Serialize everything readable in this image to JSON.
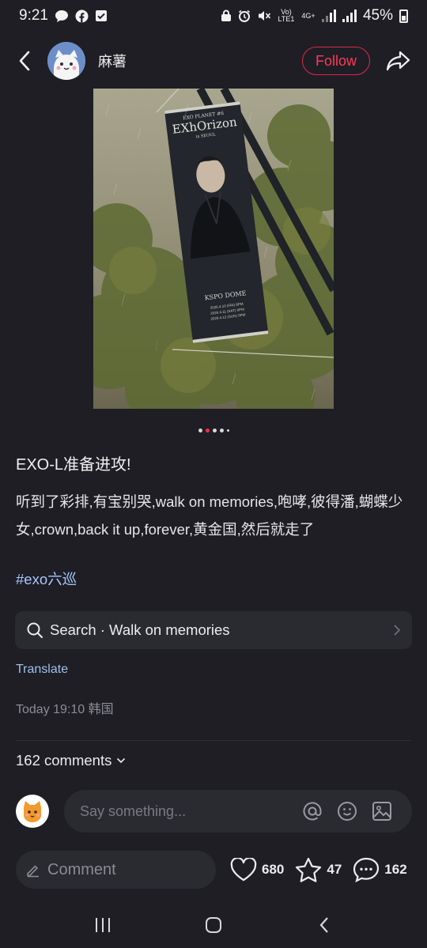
{
  "status_bar": {
    "time": "9:21",
    "network_volte": "Vo) LTE1",
    "network_type": "4G+",
    "battery": "45%",
    "left_icons": [
      "chat-bubble-icon",
      "facebook-icon",
      "check-square-icon"
    ],
    "right_icons": [
      "lock-icon",
      "alarm-icon",
      "mute-icon",
      "signal-icon",
      "signal-icon",
      "battery-icon"
    ]
  },
  "header": {
    "username": "麻薯",
    "follow_label": "Follow"
  },
  "post": {
    "carousel": {
      "count": 5,
      "active_index": 1
    },
    "title": "EXO-L准备进攻!",
    "body": "听到了彩排,有宝别哭,walk on memories,咆哮,彼得潘,蝴蝶少女,crown,back it up,forever,黄金国,然后就走了",
    "hashtag": "#exo六巡",
    "image_text": {
      "banner_top": "EXO PLANET #6",
      "banner_title": "EXhOrizon",
      "banner_sub": "in SEOUL",
      "venue": "KSPO DOME",
      "dates": [
        "2026.4.10 (FRI) 8PM",
        "2026.4.11 (SAT) 6PM",
        "2026.4.12 (SUN) 5PM"
      ]
    }
  },
  "search_suggestion": {
    "label": "Search · Walk on memories"
  },
  "translate_label": "Translate",
  "timestamp": "Today 19:10 韩国",
  "comments": {
    "count_label": "162 comments",
    "input_placeholder": "Say something..."
  },
  "bottom_bar": {
    "comment_label": "Comment",
    "likes": "680",
    "favorites": "47",
    "comments": "162"
  },
  "colors": {
    "background": "#1e1e24",
    "accent": "#ff3a5c",
    "link": "#9cc0ec"
  }
}
